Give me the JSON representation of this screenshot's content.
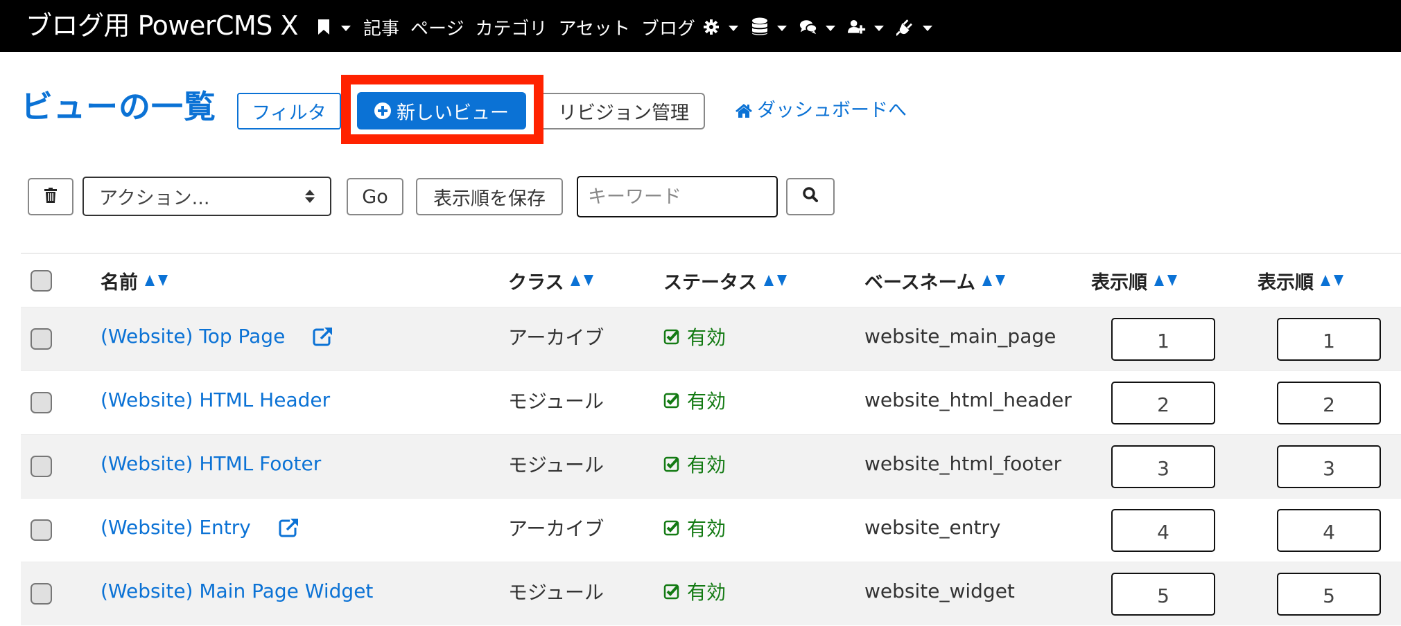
{
  "navbar": {
    "brand": "ブログ用 PowerCMS X",
    "items": [
      {
        "type": "icon-dropdown",
        "icon": "bookmark-icon"
      },
      {
        "type": "link",
        "label": "記事"
      },
      {
        "type": "link",
        "label": "ページ"
      },
      {
        "type": "link",
        "label": "カテゴリ"
      },
      {
        "type": "link",
        "label": "アセット"
      },
      {
        "type": "link",
        "label": "ブログ"
      },
      {
        "type": "icon-dropdown",
        "icon": "gear-icon"
      },
      {
        "type": "icon-dropdown",
        "icon": "database-icon"
      },
      {
        "type": "icon-dropdown",
        "icon": "comments-icon"
      },
      {
        "type": "icon-dropdown",
        "icon": "user-plus-icon"
      },
      {
        "type": "icon-dropdown",
        "icon": "plug-icon"
      }
    ]
  },
  "header": {
    "title": "ビューの一覧",
    "filter_label": "フィルタ",
    "new_view_label": "新しいビュー",
    "revision_label": "リビジョン管理",
    "dashboard_label": "ダッシュボードへ"
  },
  "toolbar": {
    "action_select_value": "アクション...",
    "go_label": "Go",
    "save_order_label": "表示順を保存",
    "keyword_placeholder": "キーワード",
    "keyword_value": ""
  },
  "table": {
    "columns": {
      "name": "名前",
      "class": "クラス",
      "status": "ステータス",
      "basename": "ベースネーム",
      "order1": "表示順",
      "order2": "表示順"
    },
    "rows": [
      {
        "name": "(Website) Top Page",
        "has_external_link": true,
        "class": "アーカイブ",
        "status": "有効",
        "basename": "website_main_page",
        "order1": "1",
        "order2": "1"
      },
      {
        "name": "(Website) HTML Header",
        "has_external_link": false,
        "class": "モジュール",
        "status": "有効",
        "basename": "website_html_header",
        "order1": "2",
        "order2": "2"
      },
      {
        "name": "(Website) HTML Footer",
        "has_external_link": false,
        "class": "モジュール",
        "status": "有効",
        "basename": "website_html_footer",
        "order1": "3",
        "order2": "3"
      },
      {
        "name": "(Website) Entry",
        "has_external_link": true,
        "class": "アーカイブ",
        "status": "有効",
        "basename": "website_entry",
        "order1": "4",
        "order2": "4"
      },
      {
        "name": "(Website) Main Page Widget",
        "has_external_link": false,
        "class": "モジュール",
        "status": "有効",
        "basename": "website_widget",
        "order1": "5",
        "order2": "5"
      }
    ]
  },
  "colors": {
    "navbar_bg": "#000000",
    "accent": "#0b72d5",
    "highlight": "#ff2200",
    "status_active": "#137a13",
    "row_stripe": "#f2f2f2"
  }
}
